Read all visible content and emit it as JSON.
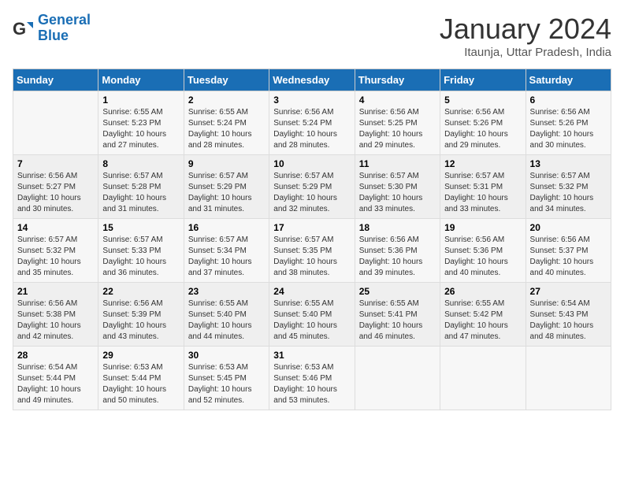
{
  "logo": {
    "line1": "General",
    "line2": "Blue"
  },
  "title": "January 2024",
  "subtitle": "Itaunja, Uttar Pradesh, India",
  "days_of_week": [
    "Sunday",
    "Monday",
    "Tuesday",
    "Wednesday",
    "Thursday",
    "Friday",
    "Saturday"
  ],
  "weeks": [
    [
      {
        "day": "",
        "sunrise": "",
        "sunset": "",
        "daylight": ""
      },
      {
        "day": "1",
        "sunrise": "Sunrise: 6:55 AM",
        "sunset": "Sunset: 5:23 PM",
        "daylight": "Daylight: 10 hours and 27 minutes."
      },
      {
        "day": "2",
        "sunrise": "Sunrise: 6:55 AM",
        "sunset": "Sunset: 5:24 PM",
        "daylight": "Daylight: 10 hours and 28 minutes."
      },
      {
        "day": "3",
        "sunrise": "Sunrise: 6:56 AM",
        "sunset": "Sunset: 5:24 PM",
        "daylight": "Daylight: 10 hours and 28 minutes."
      },
      {
        "day": "4",
        "sunrise": "Sunrise: 6:56 AM",
        "sunset": "Sunset: 5:25 PM",
        "daylight": "Daylight: 10 hours and 29 minutes."
      },
      {
        "day": "5",
        "sunrise": "Sunrise: 6:56 AM",
        "sunset": "Sunset: 5:26 PM",
        "daylight": "Daylight: 10 hours and 29 minutes."
      },
      {
        "day": "6",
        "sunrise": "Sunrise: 6:56 AM",
        "sunset": "Sunset: 5:26 PM",
        "daylight": "Daylight: 10 hours and 30 minutes."
      }
    ],
    [
      {
        "day": "7",
        "sunrise": "Sunrise: 6:56 AM",
        "sunset": "Sunset: 5:27 PM",
        "daylight": "Daylight: 10 hours and 30 minutes."
      },
      {
        "day": "8",
        "sunrise": "Sunrise: 6:57 AM",
        "sunset": "Sunset: 5:28 PM",
        "daylight": "Daylight: 10 hours and 31 minutes."
      },
      {
        "day": "9",
        "sunrise": "Sunrise: 6:57 AM",
        "sunset": "Sunset: 5:29 PM",
        "daylight": "Daylight: 10 hours and 31 minutes."
      },
      {
        "day": "10",
        "sunrise": "Sunrise: 6:57 AM",
        "sunset": "Sunset: 5:29 PM",
        "daylight": "Daylight: 10 hours and 32 minutes."
      },
      {
        "day": "11",
        "sunrise": "Sunrise: 6:57 AM",
        "sunset": "Sunset: 5:30 PM",
        "daylight": "Daylight: 10 hours and 33 minutes."
      },
      {
        "day": "12",
        "sunrise": "Sunrise: 6:57 AM",
        "sunset": "Sunset: 5:31 PM",
        "daylight": "Daylight: 10 hours and 33 minutes."
      },
      {
        "day": "13",
        "sunrise": "Sunrise: 6:57 AM",
        "sunset": "Sunset: 5:32 PM",
        "daylight": "Daylight: 10 hours and 34 minutes."
      }
    ],
    [
      {
        "day": "14",
        "sunrise": "Sunrise: 6:57 AM",
        "sunset": "Sunset: 5:32 PM",
        "daylight": "Daylight: 10 hours and 35 minutes."
      },
      {
        "day": "15",
        "sunrise": "Sunrise: 6:57 AM",
        "sunset": "Sunset: 5:33 PM",
        "daylight": "Daylight: 10 hours and 36 minutes."
      },
      {
        "day": "16",
        "sunrise": "Sunrise: 6:57 AM",
        "sunset": "Sunset: 5:34 PM",
        "daylight": "Daylight: 10 hours and 37 minutes."
      },
      {
        "day": "17",
        "sunrise": "Sunrise: 6:57 AM",
        "sunset": "Sunset: 5:35 PM",
        "daylight": "Daylight: 10 hours and 38 minutes."
      },
      {
        "day": "18",
        "sunrise": "Sunrise: 6:56 AM",
        "sunset": "Sunset: 5:36 PM",
        "daylight": "Daylight: 10 hours and 39 minutes."
      },
      {
        "day": "19",
        "sunrise": "Sunrise: 6:56 AM",
        "sunset": "Sunset: 5:36 PM",
        "daylight": "Daylight: 10 hours and 40 minutes."
      },
      {
        "day": "20",
        "sunrise": "Sunrise: 6:56 AM",
        "sunset": "Sunset: 5:37 PM",
        "daylight": "Daylight: 10 hours and 40 minutes."
      }
    ],
    [
      {
        "day": "21",
        "sunrise": "Sunrise: 6:56 AM",
        "sunset": "Sunset: 5:38 PM",
        "daylight": "Daylight: 10 hours and 42 minutes."
      },
      {
        "day": "22",
        "sunrise": "Sunrise: 6:56 AM",
        "sunset": "Sunset: 5:39 PM",
        "daylight": "Daylight: 10 hours and 43 minutes."
      },
      {
        "day": "23",
        "sunrise": "Sunrise: 6:55 AM",
        "sunset": "Sunset: 5:40 PM",
        "daylight": "Daylight: 10 hours and 44 minutes."
      },
      {
        "day": "24",
        "sunrise": "Sunrise: 6:55 AM",
        "sunset": "Sunset: 5:40 PM",
        "daylight": "Daylight: 10 hours and 45 minutes."
      },
      {
        "day": "25",
        "sunrise": "Sunrise: 6:55 AM",
        "sunset": "Sunset: 5:41 PM",
        "daylight": "Daylight: 10 hours and 46 minutes."
      },
      {
        "day": "26",
        "sunrise": "Sunrise: 6:55 AM",
        "sunset": "Sunset: 5:42 PM",
        "daylight": "Daylight: 10 hours and 47 minutes."
      },
      {
        "day": "27",
        "sunrise": "Sunrise: 6:54 AM",
        "sunset": "Sunset: 5:43 PM",
        "daylight": "Daylight: 10 hours and 48 minutes."
      }
    ],
    [
      {
        "day": "28",
        "sunrise": "Sunrise: 6:54 AM",
        "sunset": "Sunset: 5:44 PM",
        "daylight": "Daylight: 10 hours and 49 minutes."
      },
      {
        "day": "29",
        "sunrise": "Sunrise: 6:53 AM",
        "sunset": "Sunset: 5:44 PM",
        "daylight": "Daylight: 10 hours and 50 minutes."
      },
      {
        "day": "30",
        "sunrise": "Sunrise: 6:53 AM",
        "sunset": "Sunset: 5:45 PM",
        "daylight": "Daylight: 10 hours and 52 minutes."
      },
      {
        "day": "31",
        "sunrise": "Sunrise: 6:53 AM",
        "sunset": "Sunset: 5:46 PM",
        "daylight": "Daylight: 10 hours and 53 minutes."
      },
      {
        "day": "",
        "sunrise": "",
        "sunset": "",
        "daylight": ""
      },
      {
        "day": "",
        "sunrise": "",
        "sunset": "",
        "daylight": ""
      },
      {
        "day": "",
        "sunrise": "",
        "sunset": "",
        "daylight": ""
      }
    ]
  ]
}
